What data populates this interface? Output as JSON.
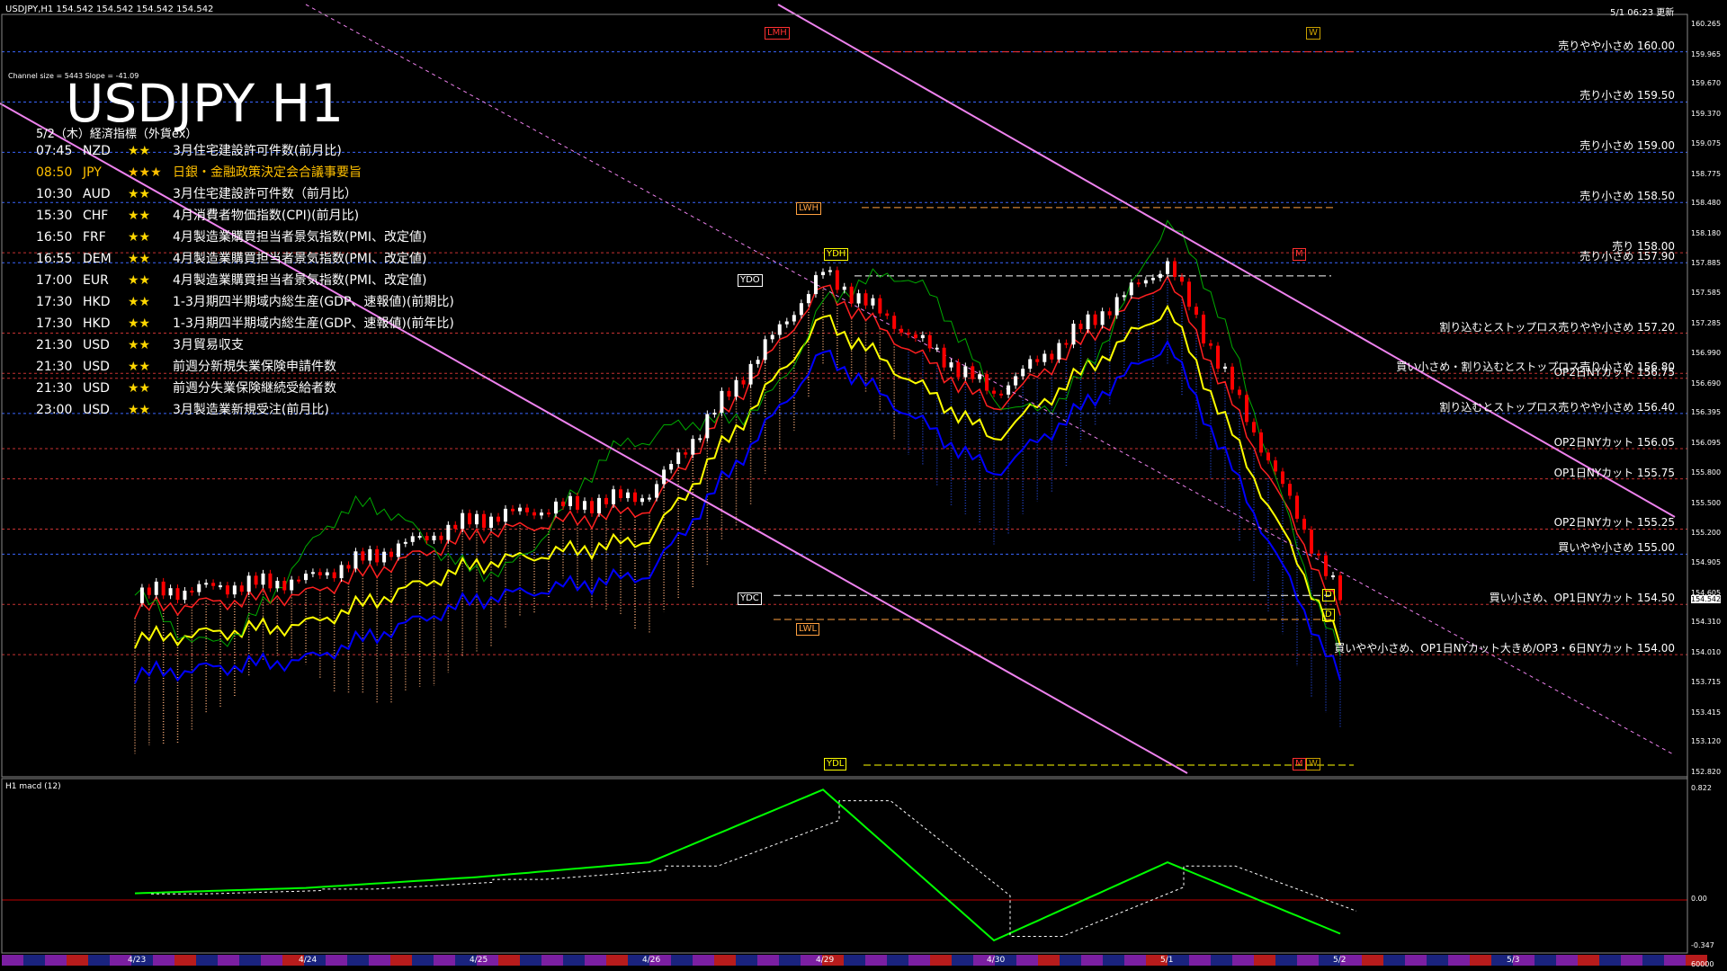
{
  "header": {
    "symbol_line": "USDJPY,H1  154.542 154.542 154.542 154.542",
    "timestamp": "5/1 06:23 更新"
  },
  "channel_info": "Channel size = 5443 Slope = -41.09",
  "title": "USDJPY H1",
  "econ_calendar": {
    "heading": "5/2（木）経済指標（外貨ex）",
    "events": [
      {
        "time": "07:45",
        "ccy": "NZD",
        "stars": "★★",
        "text": "3月住宅建設許可件数(前月比)",
        "color": "#ffffff"
      },
      {
        "time": "08:50",
        "ccy": "JPY",
        "stars": "★★★",
        "text": "日銀・金融政策決定会合議事要旨",
        "color": "#ffc000"
      },
      {
        "time": "10:30",
        "ccy": "AUD",
        "stars": "★★",
        "text": "3月住宅建設許可件数（前月比）",
        "color": "#ffffff"
      },
      {
        "time": "15:30",
        "ccy": "CHF",
        "stars": "★★",
        "text": "4月消費者物価指数(CPI)(前月比)",
        "color": "#ffffff"
      },
      {
        "time": "16:50",
        "ccy": "FRF",
        "stars": "★★",
        "text": "4月製造業購買担当者景気指数(PMI、改定値)",
        "color": "#ffffff"
      },
      {
        "time": "16:55",
        "ccy": "DEM",
        "stars": "★★",
        "text": "4月製造業購買担当者景気指数(PMI、改定値)",
        "color": "#ffffff"
      },
      {
        "time": "17:00",
        "ccy": "EUR",
        "stars": "★★",
        "text": "4月製造業購買担当者景気指数(PMI、改定値)",
        "color": "#ffffff"
      },
      {
        "time": "17:30",
        "ccy": "HKD",
        "stars": "★★",
        "text": "1-3月期四半期域内総生産(GDP、速報値)(前期比)",
        "color": "#ffffff"
      },
      {
        "time": "17:30",
        "ccy": "HKD",
        "stars": "★★",
        "text": "1-3月期四半期域内総生産(GDP、速報値)(前年比)",
        "color": "#ffffff"
      },
      {
        "time": "21:30",
        "ccy": "USD",
        "stars": "★★",
        "text": "3月貿易収支",
        "color": "#ffffff"
      },
      {
        "time": "21:30",
        "ccy": "USD",
        "stars": "★★",
        "text": "前週分新規失業保険申請件数",
        "color": "#ffffff"
      },
      {
        "time": "21:30",
        "ccy": "USD",
        "stars": "★★",
        "text": "前週分失業保険継続受給者数",
        "color": "#ffffff"
      },
      {
        "time": "23:00",
        "ccy": "USD",
        "stars": "★★",
        "text": "3月製造業新規受注(前月比)",
        "color": "#ffffff"
      }
    ]
  },
  "tags": {
    "lmh": "LMH",
    "w_top": "W",
    "lwh": "LWH",
    "ydh": "YDH",
    "ydo": "YDO",
    "ydc": "YDC",
    "lwl": "LWL",
    "ydl": "YDL",
    "m1": "M",
    "m2": "M",
    "w2": "W",
    "d1": "D",
    "d2": "D"
  },
  "levels": [
    {
      "price": 160.0,
      "text": "売りやや小さめ 160.00"
    },
    {
      "price": 159.5,
      "text": "売り小さめ 159.50"
    },
    {
      "price": 159.0,
      "text": "売り小さめ 159.00"
    },
    {
      "price": 158.5,
      "text": "売り小さめ 158.50"
    },
    {
      "price": 158.0,
      "text": "売り 158.00"
    },
    {
      "price": 157.9,
      "text": "売り小さめ 157.90"
    },
    {
      "price": 157.2,
      "text": "割り込むとストップロス売りやや小さめ 157.20"
    },
    {
      "price": 156.8,
      "text": "買い小さめ・割り込むとストップロス売り小さめ 156.80"
    },
    {
      "price": 156.75,
      "text": "OP2日NYカット 156.75"
    },
    {
      "price": 156.4,
      "text": "割り込むとストップロス売りやや小さめ 156.40"
    },
    {
      "price": 156.05,
      "text": "OP2日NYカット 156.05"
    },
    {
      "price": 155.75,
      "text": "OP1日NYカット 155.75"
    },
    {
      "price": 155.25,
      "text": "OP2日NYカット 155.25"
    },
    {
      "price": 155.0,
      "text": "買いやや小さめ 155.00"
    },
    {
      "price": 154.5,
      "text": "買い小さめ、OP1日NYカット 154.50"
    },
    {
      "price": 154.0,
      "text": "買いやや小さめ、OP1日NYカット大きめ/OP3・6日NYカット 154.00"
    }
  ],
  "price_axis": [
    "160.265",
    "159.965",
    "159.670",
    "159.370",
    "159.075",
    "158.775",
    "158.480",
    "158.180",
    "157.885",
    "157.585",
    "157.285",
    "156.990",
    "156.690",
    "156.395",
    "156.095",
    "155.800",
    "155.500",
    "155.200",
    "154.905",
    "154.605",
    "154.542",
    "154.310",
    "154.010",
    "153.715",
    "153.415",
    "153.120",
    "152.820"
  ],
  "macd_axis": [
    "0.822",
    "0.00",
    "-0.347",
    "60000"
  ],
  "macd_label": "H1  macd (12)",
  "date_labels": [
    "4/23",
    "4/24",
    "4/25",
    "4/26",
    "4/29",
    "4/30",
    "5/1",
    "5/2",
    "5/3"
  ],
  "chart_data": {
    "type": "line",
    "title": "USDJPY H1",
    "ylim": [
      152.82,
      160.265
    ],
    "x": [
      "4/23",
      "4/24",
      "4/25",
      "4/26",
      "4/29",
      "4/30",
      "5/1",
      "5/2"
    ],
    "series": [
      {
        "name": "USDJPY H1",
        "values": [
          154.6,
          154.75,
          155.35,
          155.6,
          157.8,
          156.6,
          157.9,
          154.542
        ]
      }
    ],
    "macd": {
      "ylim": [
        -0.347,
        0.822
      ],
      "values": [
        0.05,
        0.09,
        0.17,
        0.28,
        0.82,
        -0.3,
        0.28,
        -0.25
      ]
    },
    "colors": {
      "up": "#ffffff",
      "down": "#ff0000",
      "sma_fast": "#ffff00",
      "sma_slow": "#0000ff",
      "trend": "#ee82ee",
      "macd": "#00ff00",
      "signal": "#ffffff"
    }
  }
}
